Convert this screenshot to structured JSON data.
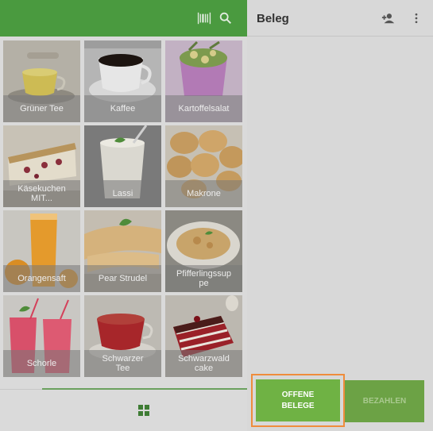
{
  "left_header": {
    "icons": [
      "barcode-icon",
      "search-icon"
    ]
  },
  "products": [
    {
      "name": "Grüner Tee",
      "lines": [
        "Grüner Tee"
      ]
    },
    {
      "name": "Kaffee",
      "lines": [
        "Kaffee"
      ]
    },
    {
      "name": "Kartoffelsalat",
      "lines": [
        "Kartoffelsalat"
      ]
    },
    {
      "name": "Käsekuchen MIT...",
      "lines": [
        "Käsekuchen",
        "MIT..."
      ]
    },
    {
      "name": "Lassi",
      "lines": [
        "Lassi"
      ]
    },
    {
      "name": "Makrone",
      "lines": [
        "Makrone"
      ]
    },
    {
      "name": "Orangensaft",
      "lines": [
        "Orangensaft"
      ]
    },
    {
      "name": "Pear Strudel",
      "lines": [
        "Pear Strudel"
      ]
    },
    {
      "name": "Pfifferlingssuppe",
      "lines": [
        "Pfifferlingssup",
        "pe"
      ]
    },
    {
      "name": "Schorle",
      "lines": [
        "Schorle"
      ]
    },
    {
      "name": "Schwarzer Tee",
      "lines": [
        "Schwarzer",
        "Tee"
      ]
    },
    {
      "name": "Schwarzwald cake",
      "lines": [
        "Schwarzwald",
        "cake"
      ]
    }
  ],
  "receipt": {
    "title": "Beleg",
    "icons": [
      "add-customer-icon",
      "more-vert-icon"
    ]
  },
  "buttons": {
    "open_line1": "OFFENE",
    "open_line2": "BELEGE",
    "pay": "BEZAHLEN"
  },
  "colors": {
    "primary": "#4a9a3f",
    "button_green": "#6fb244",
    "highlight": "#ef8c3c"
  }
}
